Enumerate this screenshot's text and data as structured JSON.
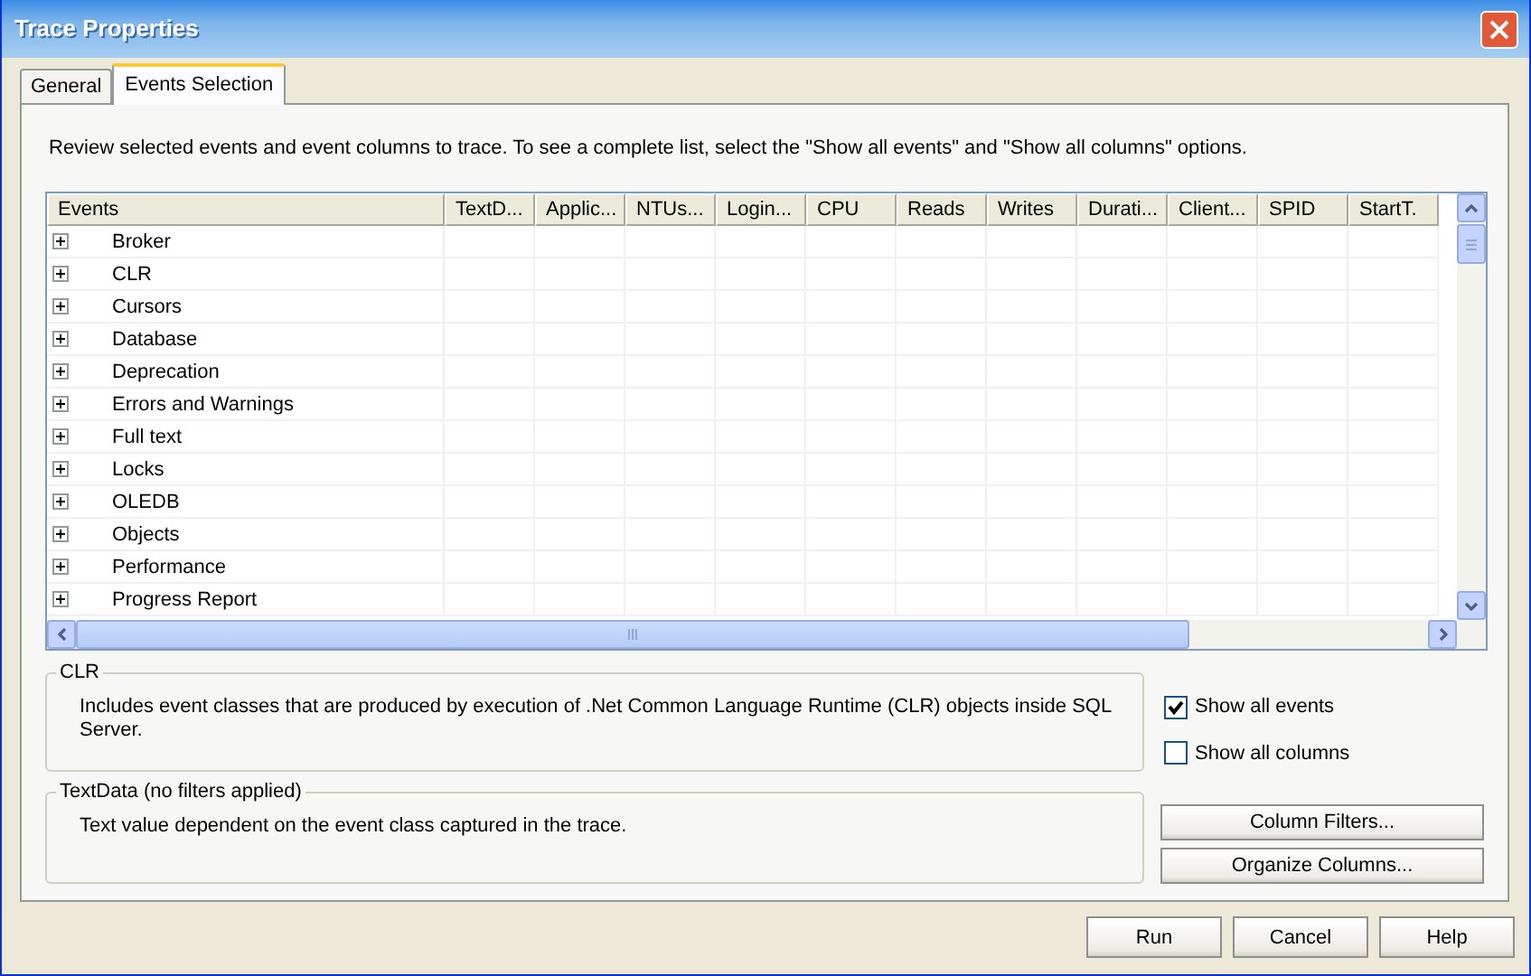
{
  "window": {
    "title": "Trace Properties"
  },
  "tabs": [
    {
      "label": "General",
      "selected": false
    },
    {
      "label": "Events Selection",
      "selected": true
    }
  ],
  "instructions": "Review selected events and event columns to trace. To see a complete list, select the \"Show all events\" and \"Show all columns\" options.",
  "grid": {
    "columns": [
      "Events",
      "TextD...",
      "Applic...",
      "NTUs...",
      "Login...",
      "CPU",
      "Reads",
      "Writes",
      "Durati...",
      "Client...",
      "SPID",
      "StartT."
    ],
    "rows": [
      {
        "name": "Broker",
        "expanded": false
      },
      {
        "name": "CLR",
        "expanded": false
      },
      {
        "name": "Cursors",
        "expanded": false
      },
      {
        "name": "Database",
        "expanded": false
      },
      {
        "name": "Deprecation",
        "expanded": false
      },
      {
        "name": "Errors and Warnings",
        "expanded": false
      },
      {
        "name": "Full text",
        "expanded": false
      },
      {
        "name": "Locks",
        "expanded": false
      },
      {
        "name": "OLEDB",
        "expanded": false
      },
      {
        "name": "Objects",
        "expanded": false
      },
      {
        "name": "Performance",
        "expanded": false
      },
      {
        "name": "Progress Report",
        "expanded": false
      }
    ]
  },
  "event_info": {
    "title": "CLR",
    "description": "Includes event classes that are produced by execution of .Net Common Language Runtime (CLR) objects inside SQL Server."
  },
  "options": [
    {
      "label": "Show all events",
      "checked": true
    },
    {
      "label": "Show all columns",
      "checked": false
    }
  ],
  "column_info": {
    "title": "TextData (no filters applied)",
    "description": "Text value dependent on the event class captured in the trace."
  },
  "side_buttons": [
    "Column Filters...",
    "Organize Columns..."
  ],
  "footer_buttons": [
    "Run",
    "Cancel",
    "Help"
  ]
}
